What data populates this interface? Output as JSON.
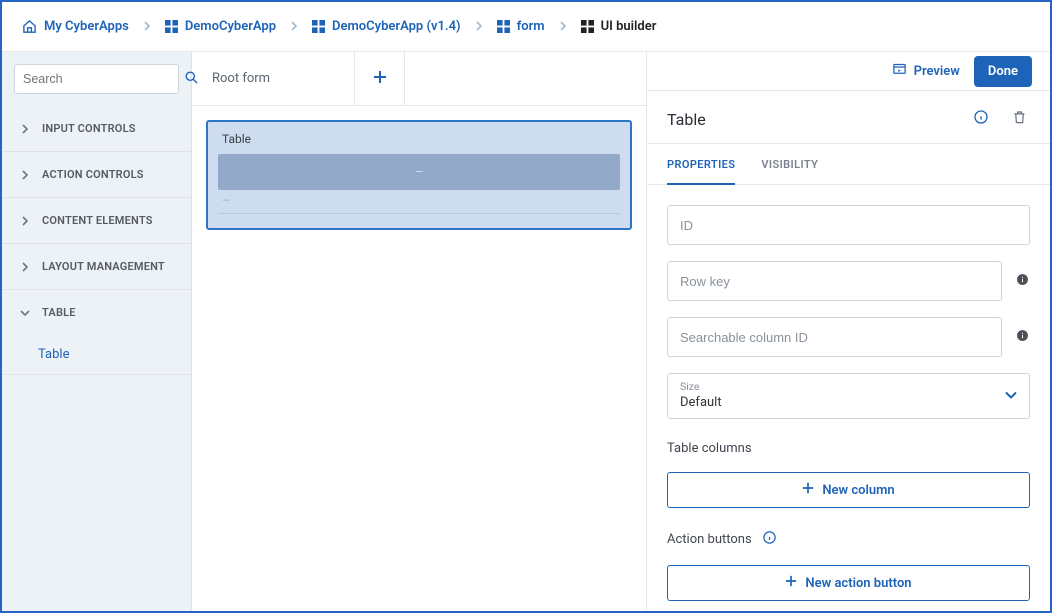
{
  "breadcrumb": [
    {
      "label": "My CyberApps",
      "icon": "home"
    },
    {
      "label": "DemoCyberApp",
      "icon": "grid4"
    },
    {
      "label": "DemoCyberApp (v1.4)",
      "icon": "grid4"
    },
    {
      "label": "form",
      "icon": "grid4"
    },
    {
      "label": "UI builder",
      "icon": "grid4-dark"
    }
  ],
  "sidebar": {
    "search_placeholder": "Search",
    "categories": {
      "input": "INPUT CONTROLS",
      "action": "ACTION CONTROLS",
      "content": "CONTENT ELEMENTS",
      "layout": "LAYOUT MANAGEMENT",
      "table": "TABLE"
    },
    "table_child": "Table"
  },
  "center": {
    "root_tab": "Root form",
    "widget_title": "Table"
  },
  "right": {
    "preview": "Preview",
    "done": "Done",
    "panel_title": "Table",
    "tabs": {
      "properties": "PROPERTIES",
      "visibility": "VISIBILITY"
    },
    "fields": {
      "id_placeholder": "ID",
      "rowkey_placeholder": "Row key",
      "searchcol_placeholder": "Searchable column ID",
      "size_label": "Size",
      "size_value": "Default"
    },
    "sections": {
      "table_columns": "Table columns",
      "new_column": "New column",
      "action_buttons": "Action buttons",
      "new_action_button": "New action button"
    }
  }
}
